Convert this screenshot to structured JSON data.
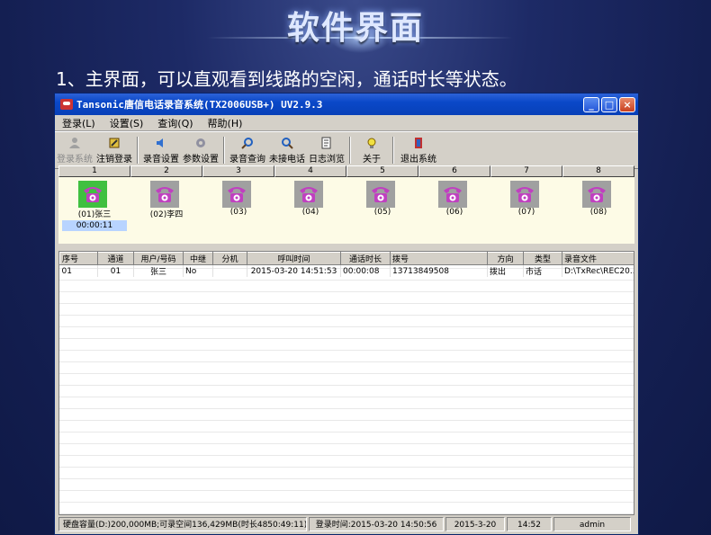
{
  "banner": {
    "title": "软件界面"
  },
  "intro": "1、主界面，可以直观看到线路的空闲，通话时长等状态。",
  "window": {
    "title": "Tansonic唐信电话录音系统(TX2006USB+) UV2.9.3",
    "controls": {
      "minimize": "_",
      "maximize": "□",
      "close": "×"
    }
  },
  "menu": [
    "登录(L)",
    "设置(S)",
    "查询(Q)",
    "帮助(H)"
  ],
  "toolbar": {
    "login": "登录系统",
    "logout": "注销登录",
    "record_settings": "录音设置",
    "param_settings": "参数设置",
    "record_query": "录音查询",
    "missed_calls": "未接电话",
    "log_view": "日志浏览",
    "about": "关于",
    "exit": "退出系统"
  },
  "lines": {
    "headers": [
      "1",
      "2",
      "3",
      "4",
      "5",
      "6",
      "7",
      "8"
    ],
    "names": [
      "(01)张三",
      "(02)李四",
      "(03)",
      "(04)",
      "(05)",
      "(06)",
      "(07)",
      "(08)"
    ],
    "timer": "00:00:11"
  },
  "table": {
    "columns": [
      "序号",
      "通道",
      "用户/号码",
      "中继",
      "分机",
      "呼叫时间",
      "通话时长",
      "拨号",
      "方向",
      "类型",
      "录音文件"
    ],
    "rows": [
      [
        "01",
        "01",
        "张三",
        "No",
        "",
        "2015-03-20 14:51:53",
        "00:00:08",
        "13713849508",
        "拨出",
        "市话",
        "D:\\TxRec\\REC20..."
      ]
    ]
  },
  "status": {
    "disk": "硬盘容量(D:)200,000MB;可录空间136,429MB(时长4850:49:11)",
    "login_time": "登录时间:2015-03-20 14:50:56",
    "date": "2015-3-20",
    "time": "14:52",
    "user": "admin"
  },
  "colors": {
    "active_line": "#40c040",
    "phone": "#c040c0",
    "title_bar": "#0a48c8"
  }
}
